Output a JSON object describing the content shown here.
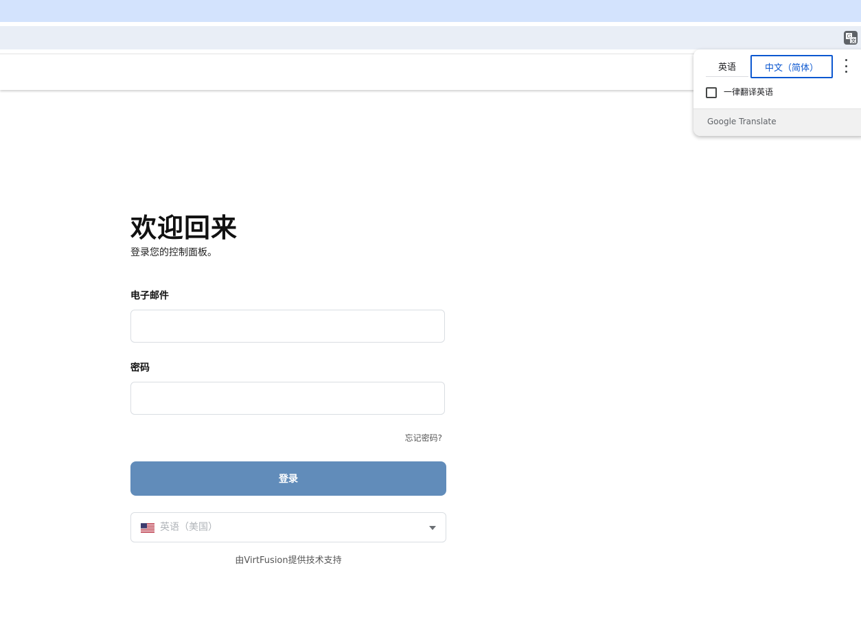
{
  "login": {
    "title": "欢迎回来",
    "subtitle": "登录您的控制面板。",
    "email_label": "电子邮件",
    "email_value": "",
    "password_label": "密码",
    "password_value": "",
    "forgot_link": "忘记密码?",
    "submit_label": "登录",
    "language_select": {
      "selected": "英语（美国）",
      "flag_icon": "us-flag-icon"
    },
    "powered_by": "由VirtFusion提供技术支持"
  },
  "translate_popup": {
    "source_tab": "英语",
    "target_tab": "中文（简体）",
    "always_translate_label": "一律翻译英语",
    "always_translate_checked": false,
    "brand_google": "Google",
    "brand_translate": "Translate"
  },
  "colors": {
    "tabstrip": "#d3e3fd",
    "toolbar": "#e9eef6",
    "submit_button": "#618cba",
    "active_tab_border": "#0b57d0"
  }
}
